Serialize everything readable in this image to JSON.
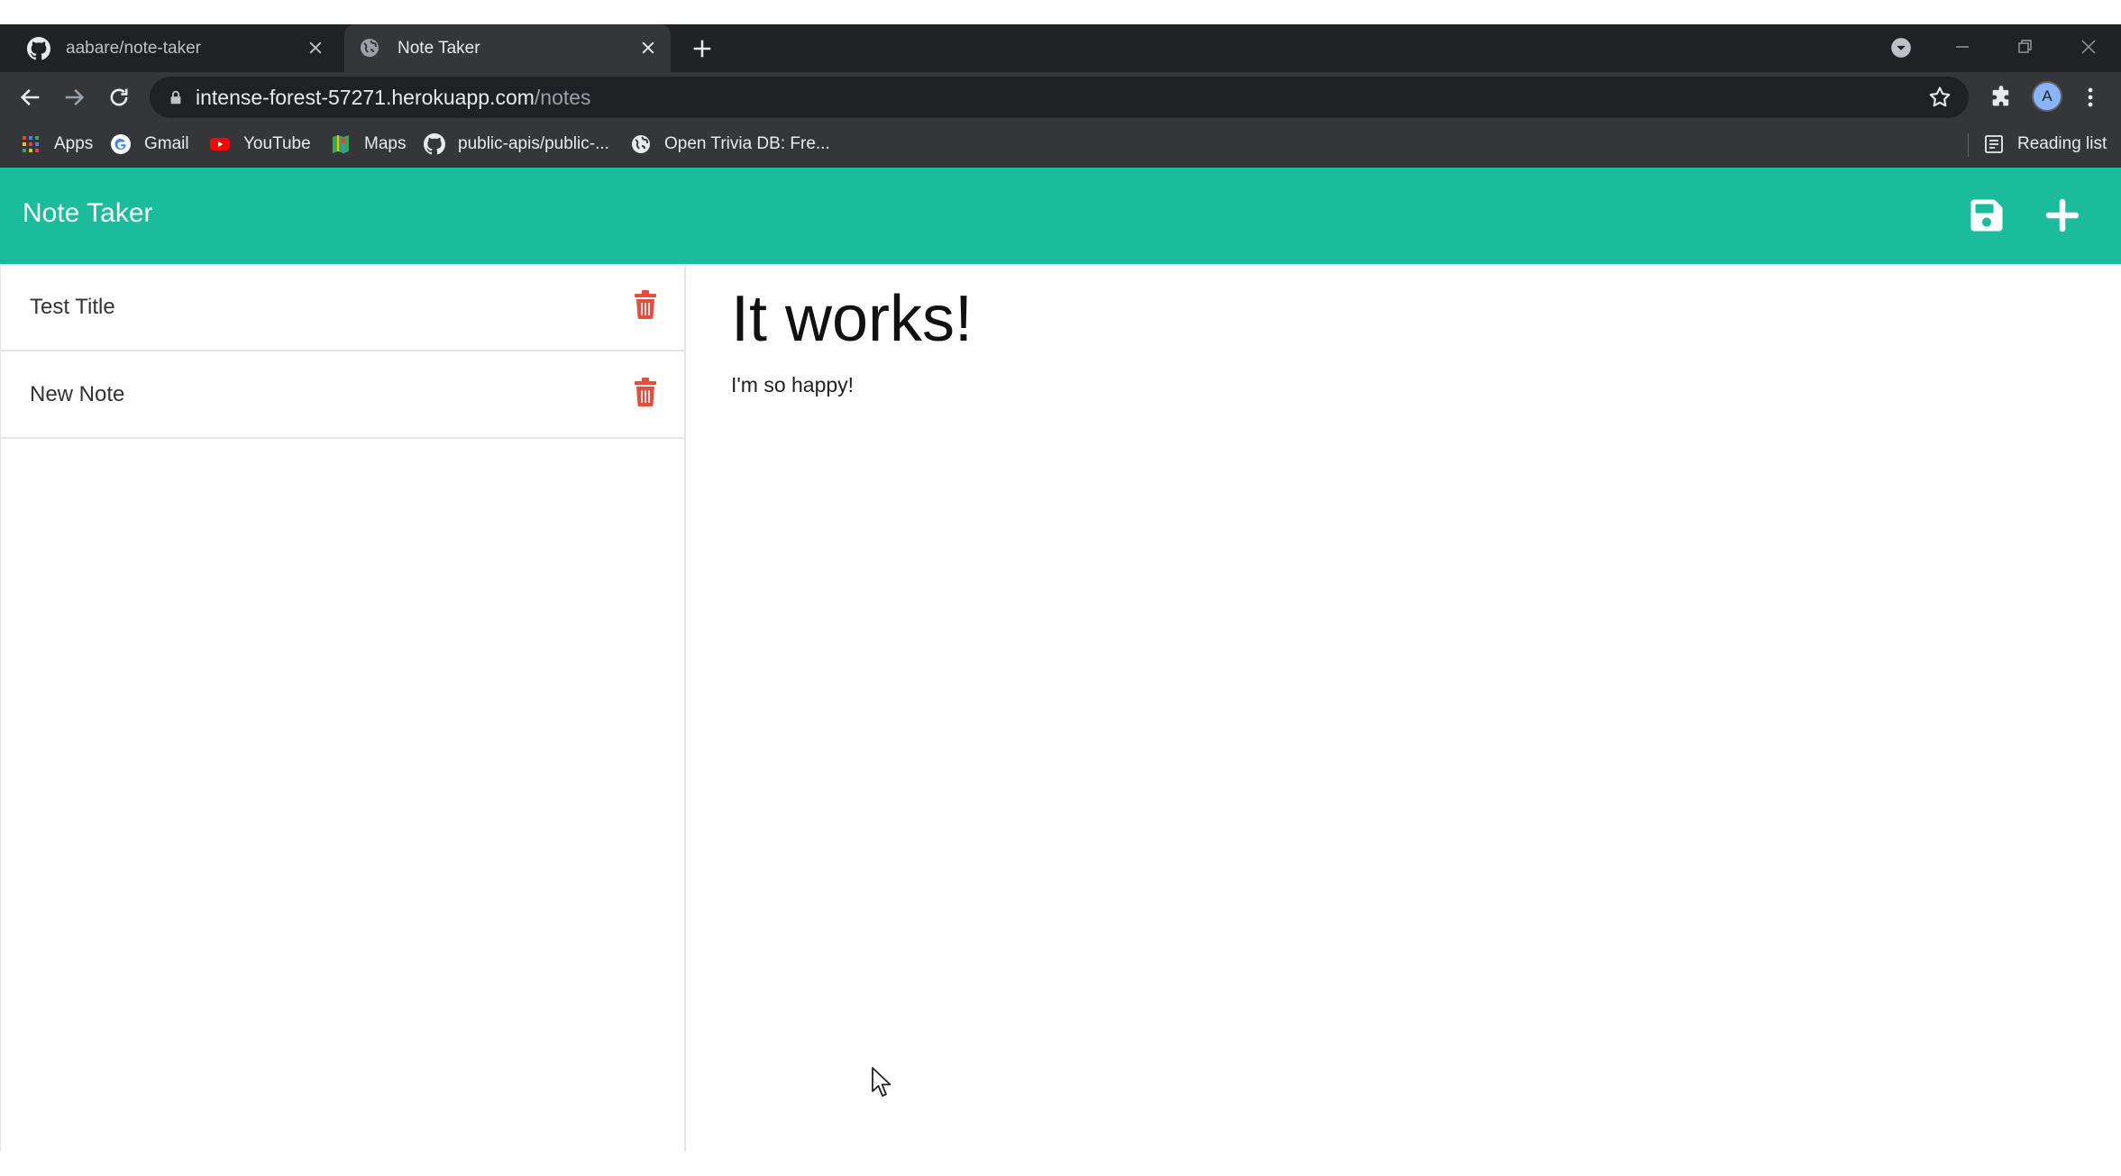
{
  "browser": {
    "tabs": [
      {
        "label": "aabare/note-taker",
        "icon": "github-icon",
        "active": false
      },
      {
        "label": "Note Taker",
        "icon": "globe-icon",
        "active": true
      }
    ],
    "address": {
      "host": "intense-forest-57271.herokuapp.com",
      "path": "/notes"
    },
    "profile_initial": "A",
    "bookmarks": [
      {
        "label": "Apps",
        "icon": "apps-grid-icon"
      },
      {
        "label": "Gmail",
        "icon": "google-icon"
      },
      {
        "label": "YouTube",
        "icon": "youtube-icon"
      },
      {
        "label": "Maps",
        "icon": "maps-icon"
      },
      {
        "label": "public-apis/public-...",
        "icon": "github-icon"
      },
      {
        "label": "Open Trivia DB: Fre...",
        "icon": "globe-icon"
      }
    ],
    "reading_list_label": "Reading list"
  },
  "app": {
    "title": "Note Taker",
    "accent_color": "#1abc9c",
    "delete_color": "#e74c3c",
    "notes": [
      {
        "title": "Test Title"
      },
      {
        "title": "New Note"
      }
    ],
    "active_note": {
      "title": "It works!",
      "text": "I'm so happy!"
    }
  }
}
